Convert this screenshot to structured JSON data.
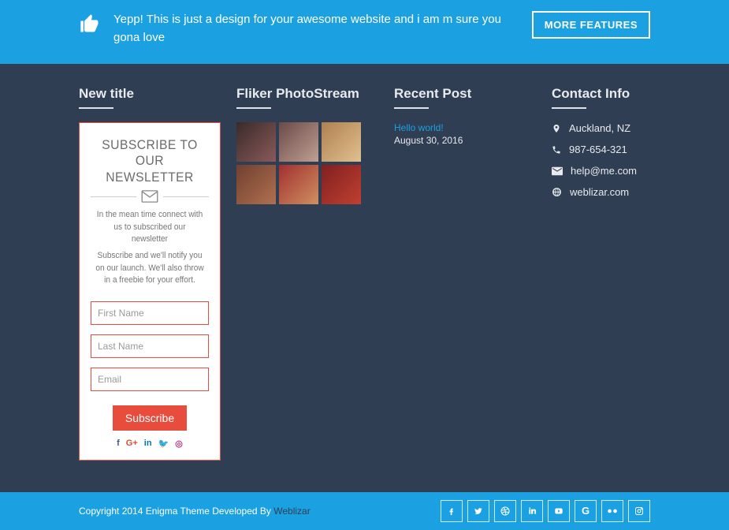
{
  "banner": {
    "message": "Yepp! This is just a design for your awesome website and i am m sure you gona love",
    "button": "MORE FEATURES"
  },
  "widgets": {
    "subscribe": {
      "title": "New title",
      "heading_l1": "SUBSCRIBE TO OUR",
      "heading_l2": "NEWSLETTER",
      "p1": "In the mean time connect with us to subscribed our newsletter",
      "p2": "Subscribe and we'll notify you on our launch. We'll also throw in a freebie for your effort.",
      "first_name_ph": "First Name",
      "last_name_ph": "Last Name",
      "email_ph": "Email",
      "button": "Subscribe",
      "socials": {
        "facebook": "f",
        "gplus": "G+",
        "linkedin": "in",
        "twitter": "🐦",
        "instagram": "◎"
      }
    },
    "flickr": {
      "title": "Fliker PhotoStream"
    },
    "recent": {
      "title": "Recent Post",
      "post_title": "Hello world!",
      "post_date": "August 30, 2016"
    },
    "contact": {
      "title": "Contact Info",
      "location": "Auckland, NZ",
      "phone": "987-654-321",
      "email": "help@me.com",
      "website": "weblizar.com"
    }
  },
  "footer": {
    "copyright": "Copyright 2014 Enigma Theme  Developed By ",
    "company": "Weblizar"
  },
  "colors": {
    "fb": "#3b5998",
    "gp": "#dd4b39",
    "in": "#0077b5",
    "tw": "#1da1f2",
    "ig": "#c13584"
  }
}
